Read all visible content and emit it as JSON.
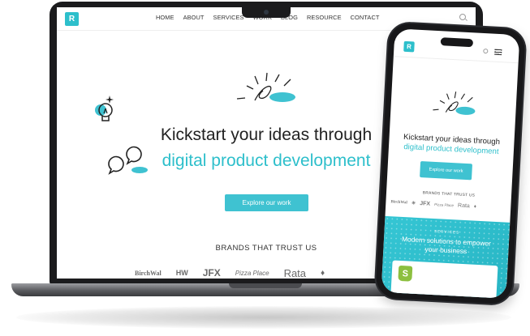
{
  "site": {
    "logo_text": "R",
    "nav": [
      "HOME",
      "ABOUT",
      "SERVICES",
      "WORK",
      "BLOG",
      "RESOURCE",
      "CONTACT"
    ],
    "hero_line1": "Kickstart your ideas through",
    "hero_line2": "digital product development",
    "cta_label": "Explore our work",
    "brands_heading": "BRANDS THAT TRUST US",
    "brands": [
      "BirchWal",
      "HW",
      "JFX",
      "Pizza Place",
      "Rata",
      "♦"
    ],
    "accent_color": "#2dbfcb"
  },
  "phone": {
    "brands": [
      "BirchWal",
      "☀",
      "JFX",
      "Pizza Place",
      "Rata",
      "♦"
    ],
    "services_label": "SERVICES",
    "services_title": "Modern solutions to empower your business",
    "card_icon": "shopify-icon"
  },
  "icons": [
    "lightbulb-icon",
    "chat-bubbles-icon",
    "sparkle-doodle-icon",
    "search-icon",
    "menu-icon"
  ]
}
